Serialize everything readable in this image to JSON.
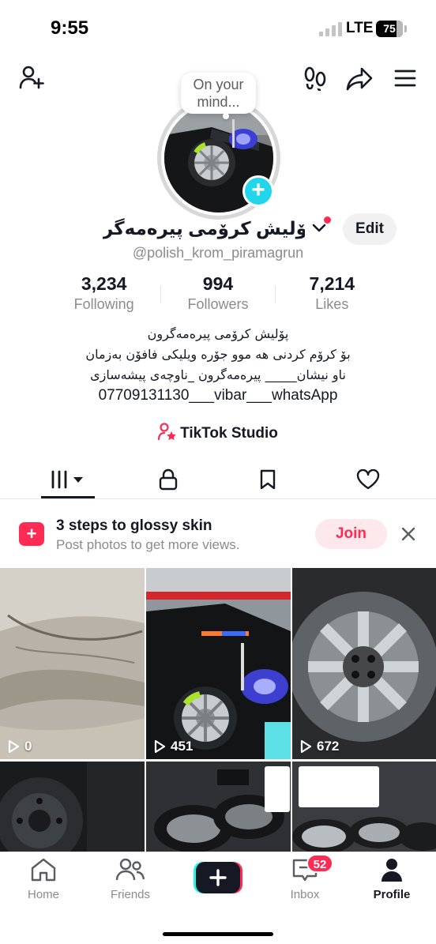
{
  "status_bar": {
    "time": "9:55",
    "network": "LTE",
    "battery": "75",
    "battery_level": 0.75
  },
  "header": {
    "add_friend_icon": "person-plus-icon",
    "footprint_icon": "footprints-icon",
    "share_icon": "share-arrow-icon",
    "menu_icon": "hamburger-menu-icon"
  },
  "profile": {
    "bubble_text": "On your mind...",
    "display_name": "پۆلیش کرۆمی پیرەمەگر...",
    "username": "@polish_krom_piramagrun",
    "edit_label": "Edit",
    "stats": [
      {
        "value": "3,234",
        "label": "Following"
      },
      {
        "value": "994",
        "label": "Followers"
      },
      {
        "value": "7,214",
        "label": "Likes"
      }
    ],
    "bio": [
      "پۆلیش کرۆمی پیرەمەگرون",
      "بۆ کرۆم کردنی هە موو جۆرە ویلیکی فافۆن بەزمان",
      "ناو نیشان_____ پیرەمەگرون _ناوچەی پیشەسازی",
      "07709131130___vibar___whatsApp"
    ],
    "studio_label": "TikTok Studio"
  },
  "tabs": [
    {
      "name": "videos",
      "icon": "grid-icon",
      "active": true
    },
    {
      "name": "private",
      "icon": "lock-icon"
    },
    {
      "name": "saved",
      "icon": "bookmark-icon"
    },
    {
      "name": "liked",
      "icon": "heart-icon"
    }
  ],
  "banner": {
    "title": "3 steps to glossy skin",
    "subtitle": "Post photos to get more views.",
    "join_label": "Join",
    "accent": "#fe2c55"
  },
  "videos": [
    {
      "views": "0"
    },
    {
      "views": "451"
    },
    {
      "views": "672"
    },
    {
      "views": ""
    },
    {
      "views": ""
    },
    {
      "views": ""
    }
  ],
  "bottom_nav": {
    "items": [
      {
        "label": "Home",
        "icon": "home-icon"
      },
      {
        "label": "Friends",
        "icon": "friends-icon"
      },
      {
        "label": "",
        "icon": "plus-icon"
      },
      {
        "label": "Inbox",
        "icon": "inbox-icon",
        "badge": "52"
      },
      {
        "label": "Profile",
        "icon": "profile-icon",
        "active": true
      }
    ]
  }
}
